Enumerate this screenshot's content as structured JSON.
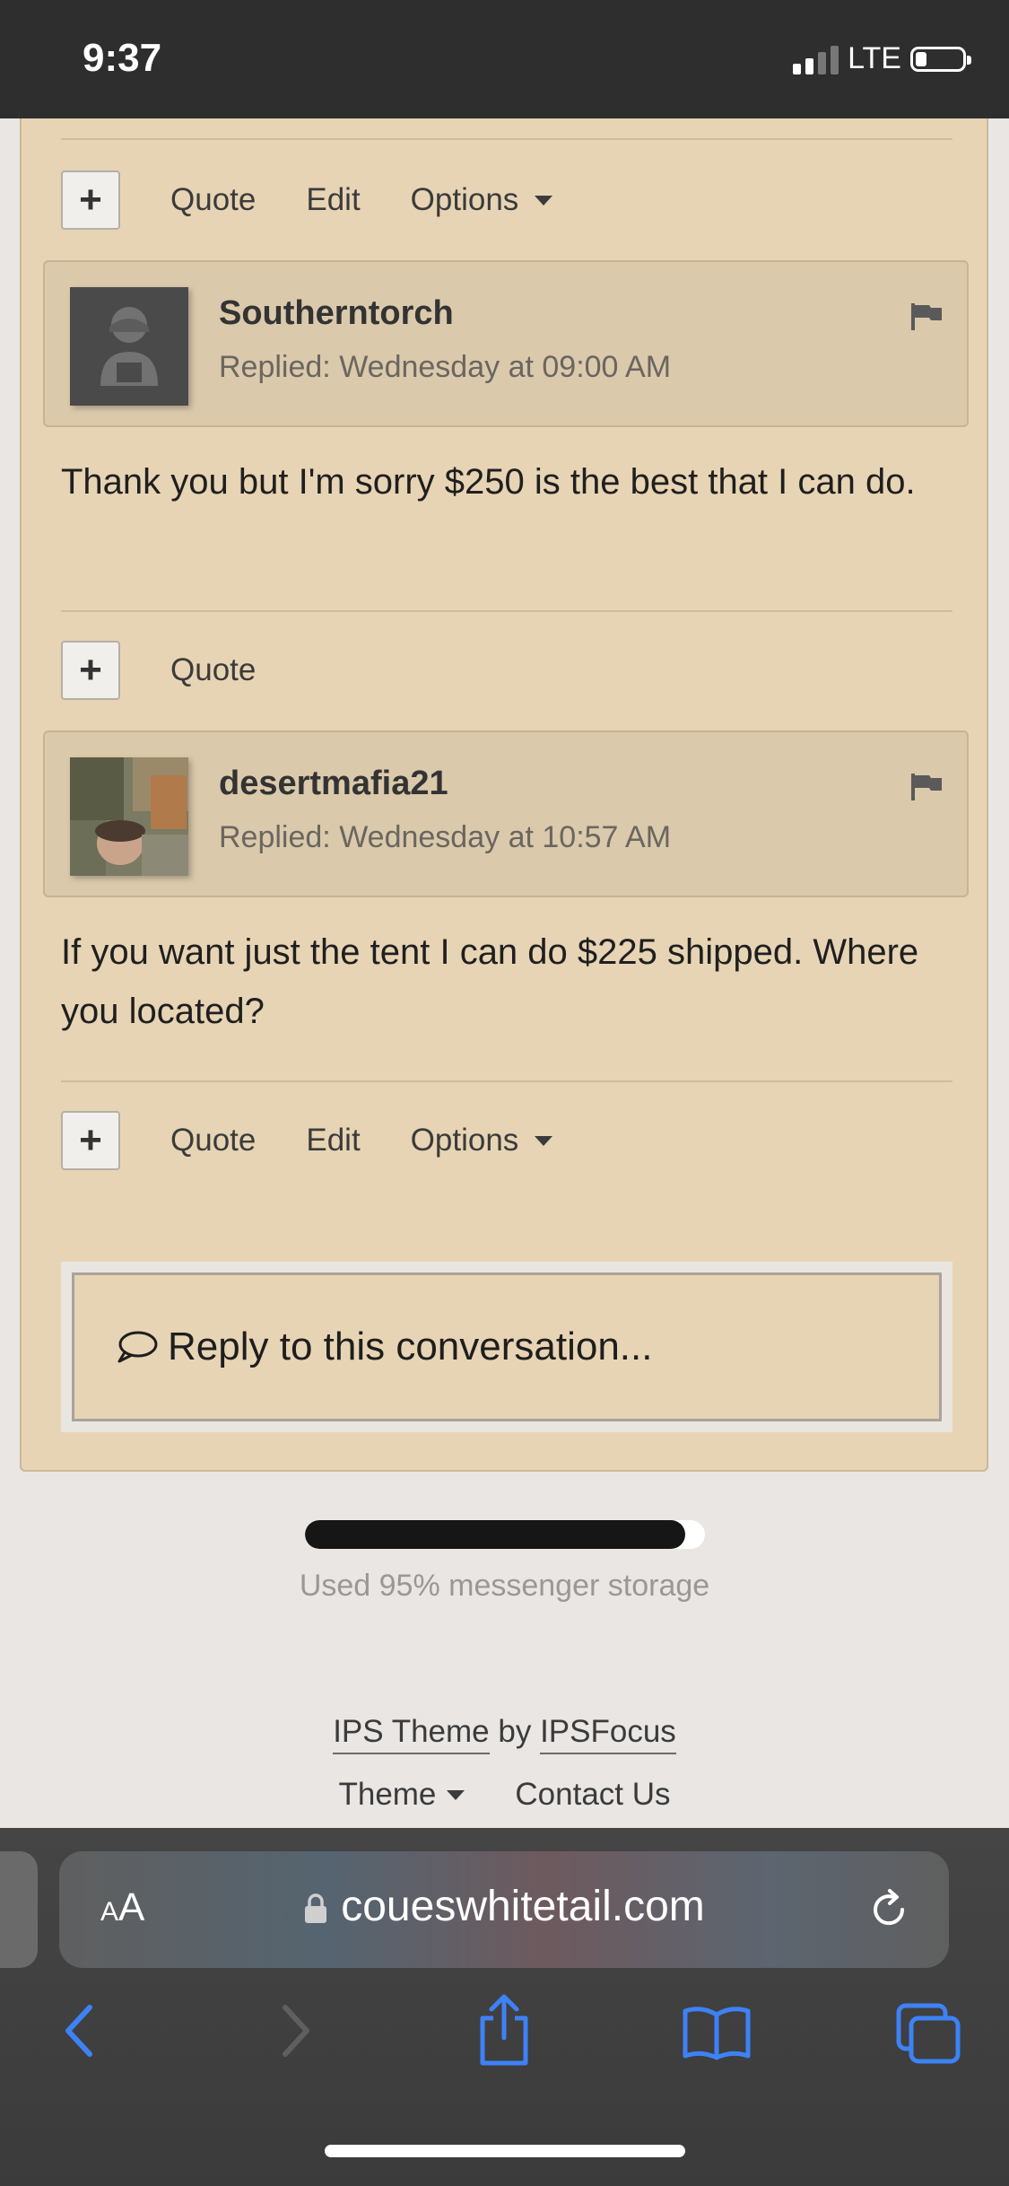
{
  "status_bar": {
    "time": "9:37",
    "network": "LTE"
  },
  "posts": [
    {
      "actions": [
        "Quote",
        "Edit",
        "Options"
      ]
    },
    {
      "author": "Southerntorch",
      "replied": "Replied: Wednesday at 09:00 AM",
      "body": "Thank you but I'm sorry $250 is the best that I can do.",
      "actions": [
        "Quote"
      ]
    },
    {
      "author": "desertmafia21",
      "replied": "Replied: Wednesday at 10:57 AM",
      "body": "If you want just the tent I can do $225 shipped. Where you located?",
      "actions": [
        "Quote",
        "Edit",
        "Options"
      ]
    }
  ],
  "reply": {
    "label": "Reply to this conversation..."
  },
  "storage": {
    "used_fraction": 0.95,
    "text": "Used 95% messenger storage"
  },
  "footer": {
    "theme_credit": "IPS Theme",
    "by": "by",
    "focus_credit": "IPSFocus",
    "theme_link": "Theme",
    "contact_link": "Contact Us"
  },
  "browser": {
    "aa_large": "A",
    "aa_small": "A",
    "url": "coueswhitetail.com"
  },
  "colors": {
    "panel": "#e7d4b4",
    "accent_blue": "#3d82f6"
  }
}
